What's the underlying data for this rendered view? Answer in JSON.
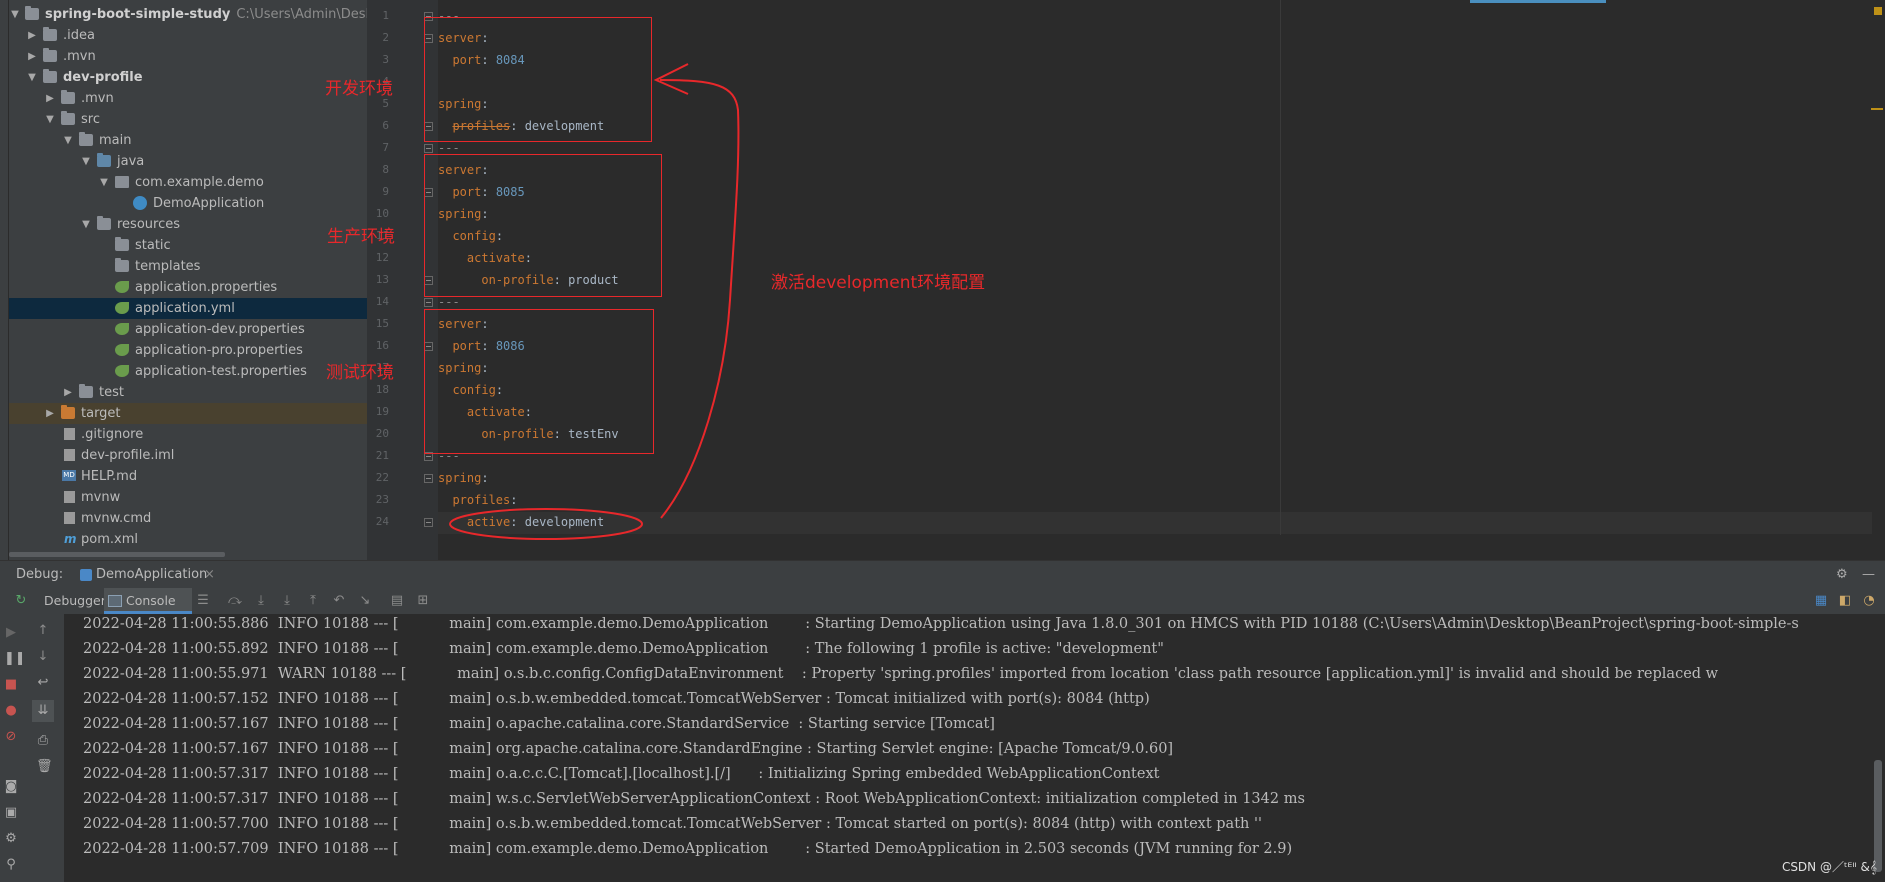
{
  "project": {
    "root_label": "spring-boot-simple-study",
    "root_path": "C:\\Users\\Admin\\Desktop\\B",
    "items": [
      {
        "label": ".idea"
      },
      {
        "label": ".mvn"
      },
      {
        "label": "dev-profile"
      },
      {
        "label": ".mvn"
      },
      {
        "label": "src"
      },
      {
        "label": "main"
      },
      {
        "label": "java"
      },
      {
        "label": "com.example.demo"
      },
      {
        "label": "DemoApplication"
      },
      {
        "label": "resources"
      },
      {
        "label": "static"
      },
      {
        "label": "templates"
      },
      {
        "label": "application.properties"
      },
      {
        "label": "application.yml"
      },
      {
        "label": "application-dev.properties"
      },
      {
        "label": "application-pro.properties"
      },
      {
        "label": "application-test.properties"
      },
      {
        "label": "test"
      },
      {
        "label": "target"
      },
      {
        "label": ".gitignore"
      },
      {
        "label": "dev-profile.iml"
      },
      {
        "label": "HELP.md"
      },
      {
        "label": "mvnw"
      },
      {
        "label": "mvnw.cmd"
      },
      {
        "label": "pom.xml"
      }
    ]
  },
  "editor": {
    "line_numbers": [
      "1",
      "2",
      "3",
      "4",
      "5",
      "6",
      "7",
      "8",
      "9",
      "10",
      "11",
      "12",
      "13",
      "14",
      "15",
      "16",
      "17",
      "18",
      "19",
      "20",
      "21",
      "22",
      "23",
      "24"
    ],
    "code": {
      "separator": "---",
      "server": "server",
      "port": "port",
      "spring": "spring",
      "profiles": "profiles",
      "config": "config",
      "activate": "activate",
      "on_profile": "on-profile",
      "active": "active",
      "port_dev": "8084",
      "port_pro": "8085",
      "port_test": "8086",
      "profile_dev": "development",
      "profile_pro": "product",
      "profile_test": "testEnv",
      "active_value": "development"
    }
  },
  "annotations": {
    "dev_label": "开发环境",
    "pro_label": "生产环境",
    "test_label": "测试环境",
    "arrow_label": "激活development环境配置",
    "color": "#e8282b"
  },
  "debug": {
    "title": "Debug:",
    "run_config": "DemoApplication",
    "tabs": {
      "debugger": "Debugger",
      "console": "Console"
    },
    "logs": [
      {
        "date": "2022-04-28",
        "time": "11:00:55.886",
        "level": "INFO",
        "pid": "10188",
        "thread": "main",
        "logger": "com.example.demo.DemoApplication",
        "message": "Starting DemoApplication using Java 1.8.0_301 on HMCS with PID 10188 (C:\\Users\\Admin\\Desktop\\BeanProject\\spring-boot-simple-s"
      },
      {
        "date": "2022-04-28",
        "time": "11:00:55.892",
        "level": "INFO",
        "pid": "10188",
        "thread": "main",
        "logger": "com.example.demo.DemoApplication",
        "message": "The following 1 profile is active: \"development\""
      },
      {
        "date": "2022-04-28",
        "time": "11:00:55.971",
        "level": "WARN",
        "pid": "10188",
        "thread": "main",
        "logger": "o.s.b.c.config.ConfigDataEnvironment",
        "message": "Property 'spring.profiles' imported from location 'class path resource [application.yml]' is invalid and should be replaced w"
      },
      {
        "date": "2022-04-28",
        "time": "11:00:57.152",
        "level": "INFO",
        "pid": "10188",
        "thread": "main",
        "logger": "o.s.b.w.embedded.tomcat.TomcatWebServer",
        "message": "Tomcat initialized with port(s): 8084 (http)"
      },
      {
        "date": "2022-04-28",
        "time": "11:00:57.167",
        "level": "INFO",
        "pid": "10188",
        "thread": "main",
        "logger": "o.apache.catalina.core.StandardService",
        "message": "Starting service [Tomcat]"
      },
      {
        "date": "2022-04-28",
        "time": "11:00:57.167",
        "level": "INFO",
        "pid": "10188",
        "thread": "main",
        "logger": "org.apache.catalina.core.StandardEngine",
        "message": "Starting Servlet engine: [Apache Tomcat/9.0.60]"
      },
      {
        "date": "2022-04-28",
        "time": "11:00:57.317",
        "level": "INFO",
        "pid": "10188",
        "thread": "main",
        "logger": "o.a.c.c.C.[Tomcat].[localhost].[/]",
        "message": "Initializing Spring embedded WebApplicationContext"
      },
      {
        "date": "2022-04-28",
        "time": "11:00:57.317",
        "level": "INFO",
        "pid": "10188",
        "thread": "main",
        "logger": "w.s.c.ServletWebServerApplicationContext",
        "message": "Root WebApplicationContext: initialization completed in 1342 ms"
      },
      {
        "date": "2022-04-28",
        "time": "11:00:57.700",
        "level": "INFO",
        "pid": "10188",
        "thread": "main",
        "logger": "o.s.b.w.embedded.tomcat.TomcatWebServer",
        "message": "Tomcat started on port(s): 8084 (http) with context path ''"
      },
      {
        "date": "2022-04-28",
        "time": "11:00:57.709",
        "level": "INFO",
        "pid": "10188",
        "thread": "main",
        "logger": "com.example.demo.DemoApplication",
        "message": "Started DemoApplication in 2.503 seconds (JVM running for 2.9)"
      }
    ]
  },
  "watermark": "CSDN @／ᵗᴱᴵᴵ &𝄞"
}
